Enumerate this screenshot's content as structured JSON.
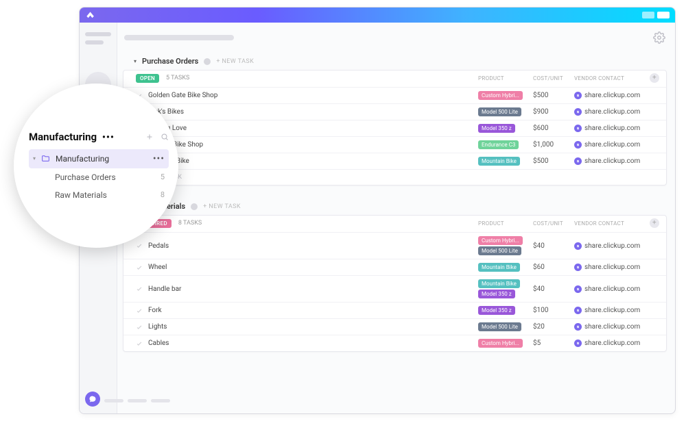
{
  "sidebar": {
    "space_title": "Manufacturing",
    "folder_label": "Manufacturing",
    "lists": [
      {
        "label": "Purchase Orders",
        "count": "5"
      },
      {
        "label": "Raw Materials",
        "count": "8"
      }
    ]
  },
  "common": {
    "new_task": "+ NEW TASK",
    "add_task": "+ ADD TASK",
    "col_product": "PRODUCT",
    "col_cost": "COST/UNIT",
    "col_vendor": "VENDOR CONTACT"
  },
  "lists": [
    {
      "title": "Purchase Orders",
      "status_label": "OPEN",
      "status_class": "status-open",
      "task_count": "5 TASKS",
      "tasks": [
        {
          "name": "Golden Gate Bike Shop",
          "tags": [
            {
              "text": "Custom Hybri...",
              "color": "tag-pink"
            }
          ],
          "cost": "$500",
          "vendor": "share.clickup.com"
        },
        {
          "name": "Rick's Bikes",
          "tags": [
            {
              "text": "Model 500 Lite",
              "color": "tag-slate"
            }
          ],
          "cost": "$900",
          "vendor": "share.clickup.com"
        },
        {
          "name": "Cycling Love",
          "tags": [
            {
              "text": "Model 350 z",
              "color": "tag-purple"
            }
          ],
          "cost": "$600",
          "vendor": "share.clickup.com"
        },
        {
          "name": "Jenna's Bike Shop",
          "tags": [
            {
              "text": "Endurance C3",
              "color": "tag-green"
            }
          ],
          "cost": "$1,000",
          "vendor": "share.clickup.com"
        },
        {
          "name": "Rainbow Bike",
          "tags": [
            {
              "text": "Mountain Bike",
              "color": "tag-teal"
            }
          ],
          "cost": "$500",
          "vendor": "share.clickup.com"
        }
      ],
      "show_add_task": true
    },
    {
      "title": "aw Materials",
      "status_label": "REQUIRED",
      "status_class": "status-required",
      "task_count": "8 TASKS",
      "tasks": [
        {
          "name": "Pedals",
          "tags": [
            {
              "text": "Custom Hybri...",
              "color": "tag-pink"
            },
            {
              "text": "Model 500 Lite",
              "color": "tag-slate"
            }
          ],
          "cost": "$40",
          "vendor": "share.clickup.com"
        },
        {
          "name": "Wheel",
          "tags": [
            {
              "text": "Mountain Bike",
              "color": "tag-teal"
            }
          ],
          "cost": "$60",
          "vendor": "share.clickup.com"
        },
        {
          "name": "Handle bar",
          "tags": [
            {
              "text": "Mountain Bike",
              "color": "tag-teal"
            },
            {
              "text": "Model 350 z",
              "color": "tag-purple"
            }
          ],
          "cost": "$40",
          "vendor": "share.clickup.com"
        },
        {
          "name": "Fork",
          "tags": [
            {
              "text": "Model 350 z",
              "color": "tag-purple"
            }
          ],
          "cost": "$100",
          "vendor": "share.clickup.com"
        },
        {
          "name": "Lights",
          "tags": [
            {
              "text": "Model 500 Lite",
              "color": "tag-slate"
            }
          ],
          "cost": "$20",
          "vendor": "share.clickup.com"
        },
        {
          "name": "Cables",
          "tags": [
            {
              "text": "Custom Hybri...",
              "color": "tag-pink"
            }
          ],
          "cost": "$5",
          "vendor": "share.clickup.com"
        }
      ],
      "show_add_task": false
    }
  ]
}
